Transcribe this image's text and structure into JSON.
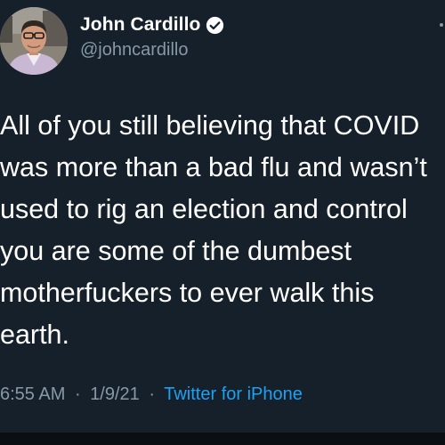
{
  "colors": {
    "background": "#15202b",
    "primary_text": "#ffffff",
    "secondary_text": "#8899a6",
    "accent": "#1da1f2"
  },
  "author": {
    "display_name": "John Cardillo",
    "handle": "@johncardillo",
    "verified_icon": "verified-badge-icon",
    "avatar": "profile-photo"
  },
  "tweet": {
    "lines": [
      "All of you still believing that COVID",
      "was more than a bad flu and wasn’t",
      "used to rig an election and control",
      "you are some of the dumbest",
      "motherfuckers to ever walk this",
      "earth."
    ],
    "time": "6:55 AM",
    "date": "1/9/21",
    "separator": "·",
    "source": "Twitter for iPhone"
  }
}
